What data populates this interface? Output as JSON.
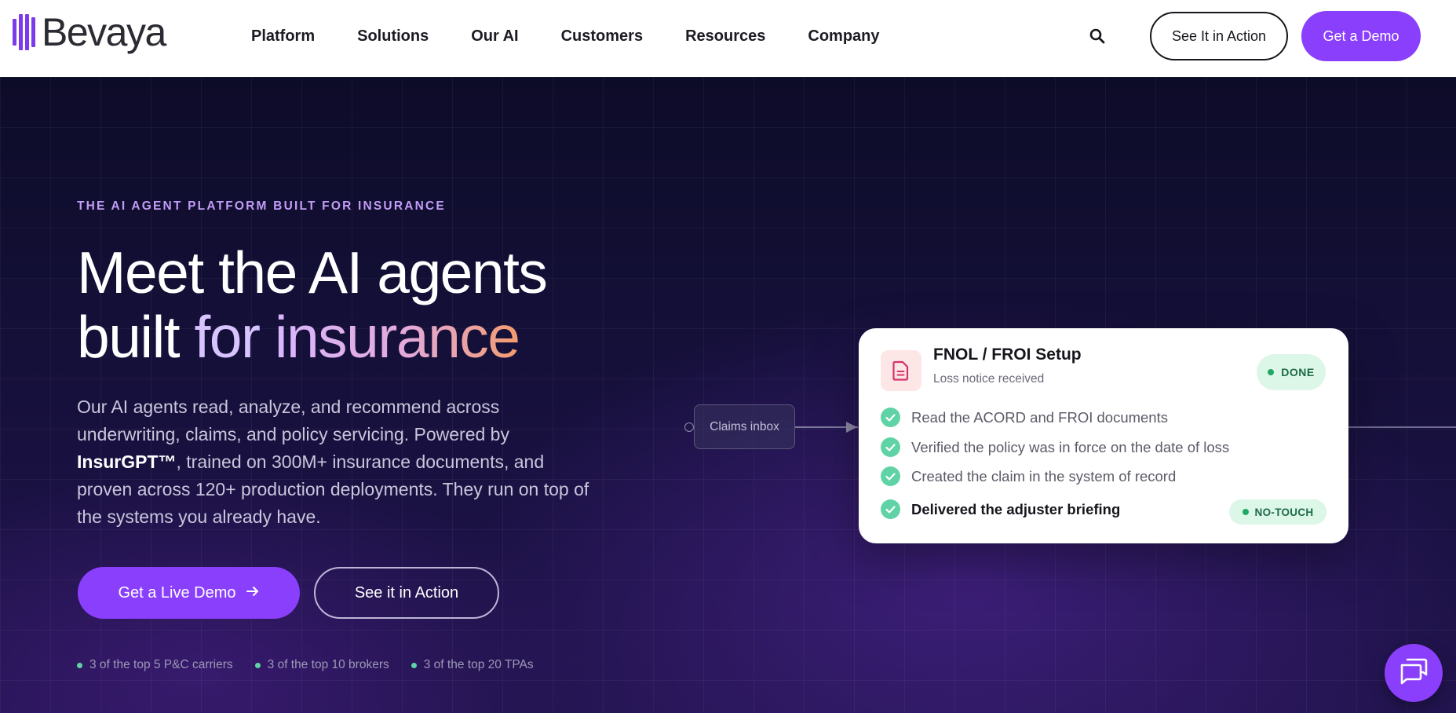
{
  "brand": {
    "name": "Bevaya",
    "accent_color": "#8a3ffc"
  },
  "nav": {
    "items": [
      {
        "label": "Platform"
      },
      {
        "label": "Solutions"
      },
      {
        "label": "Our AI"
      },
      {
        "label": "Customers"
      },
      {
        "label": "Resources"
      },
      {
        "label": "Company"
      }
    ],
    "search_icon": "search-icon",
    "see_action_label": "See It in Action",
    "get_demo_label": "Get a Demo"
  },
  "hero": {
    "eyebrow": "THE AI AGENT PLATFORM BUILT FOR INSURANCE",
    "headline_line1": "Meet the AI agents",
    "headline_built": "built ",
    "headline_for": "for ",
    "headline_insurance": "insurance",
    "description_part1": "Our AI agents read, analyze, and recommend across underwriting, claims, and policy servicing. Powered by ",
    "description_strong": "InsurGPT™",
    "description_part2": ", trained on 300M+ insurance documents, and proven across 120+ production deployments. They run on top of the systems you already have.",
    "cta_primary": "Get a Live Demo",
    "cta_secondary": "See it in Action",
    "stats": [
      {
        "label": "3 of the top 5 P&C carriers"
      },
      {
        "label": "3 of the top 10 brokers"
      },
      {
        "label": "3 of the top 20 TPAs"
      }
    ]
  },
  "flow": {
    "source_label": "Claims inbox",
    "card": {
      "title": "FNOL / FROI Setup",
      "subtitle": "Loss notice received",
      "status": "DONE",
      "steps": [
        {
          "label": "Read the ACORD and FROI documents"
        },
        {
          "label": "Verified the policy was in force on the date of loss"
        },
        {
          "label": "Created the claim in the system of record"
        },
        {
          "label": "Delivered the adjuster briefing"
        }
      ],
      "final_badge": "NO-TOUCH"
    }
  },
  "chat": {
    "icon": "chat-icon"
  }
}
